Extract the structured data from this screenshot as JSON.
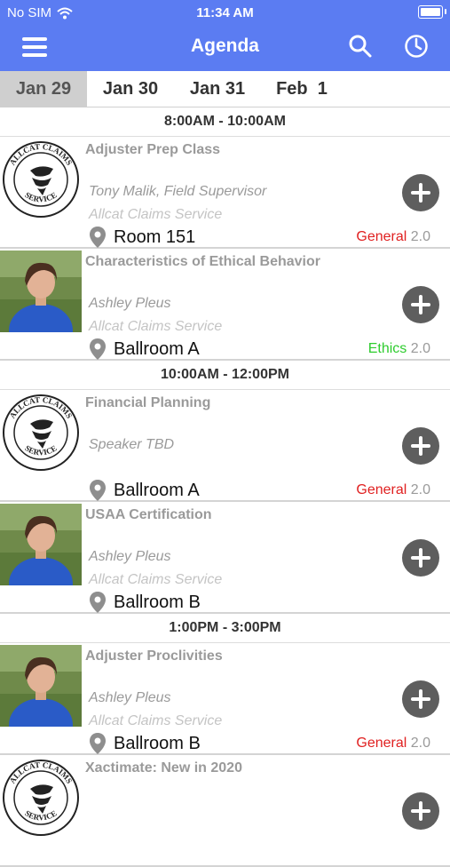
{
  "status_bar": {
    "carrier": "No SIM",
    "time": "11:34 AM"
  },
  "nav": {
    "title": "Agenda",
    "icons": [
      "menu-icon",
      "search-icon",
      "clock-icon"
    ]
  },
  "colors": {
    "header": "#5b7cf2",
    "general": "#e02020",
    "ethics": "#2ecc2e",
    "active_tab": "#cfcfcf"
  },
  "tabs": [
    {
      "label": "Jan 29",
      "active": true
    },
    {
      "label": "Jan 30",
      "active": false
    },
    {
      "label": "Jan 31",
      "active": false
    },
    {
      "label": "Feb  1",
      "active": false
    }
  ],
  "agenda": [
    {
      "time": "8:00AM - 10:00AM",
      "sessions": [
        {
          "title": "Adjuster Prep Class",
          "speaker": "Tony Malik, Field Supervisor",
          "company": "Allcat Claims Service",
          "room": "Room 151",
          "track": "General",
          "track_color": "#e02020",
          "credits": "2.0",
          "image": "logo"
        },
        {
          "title": "Characteristics of Ethical Behavior",
          "speaker": "Ashley Pleus",
          "company": "Allcat Claims Service",
          "room": "Ballroom A",
          "track": "Ethics",
          "track_color": "#2ecc2e",
          "credits": "2.0",
          "image": "photo"
        }
      ]
    },
    {
      "time": "10:00AM - 12:00PM",
      "sessions": [
        {
          "title": "Financial Planning",
          "speaker": "Speaker TBD",
          "company": "",
          "room": "Ballroom A",
          "track": "General",
          "track_color": "#e02020",
          "credits": "2.0",
          "image": "logo"
        },
        {
          "title": "USAA Certification",
          "speaker": "Ashley Pleus",
          "company": "Allcat Claims Service",
          "room": "Ballroom B",
          "track": "",
          "track_color": "",
          "credits": "",
          "image": "photo"
        }
      ]
    },
    {
      "time": "1:00PM - 3:00PM",
      "sessions": [
        {
          "title": "Adjuster Proclivities",
          "speaker": "Ashley Pleus",
          "company": "Allcat Claims Service",
          "room": "Ballroom B",
          "track": "General",
          "track_color": "#e02020",
          "credits": "2.0",
          "image": "photo"
        },
        {
          "title": "Xactimate: New in 2020",
          "speaker": "",
          "company": "",
          "room": "",
          "track": "",
          "track_color": "",
          "credits": "",
          "image": "logo"
        }
      ]
    }
  ],
  "logo": {
    "top_text": "ALLCAT CLAIMS",
    "bottom_text": "SERVICE"
  }
}
